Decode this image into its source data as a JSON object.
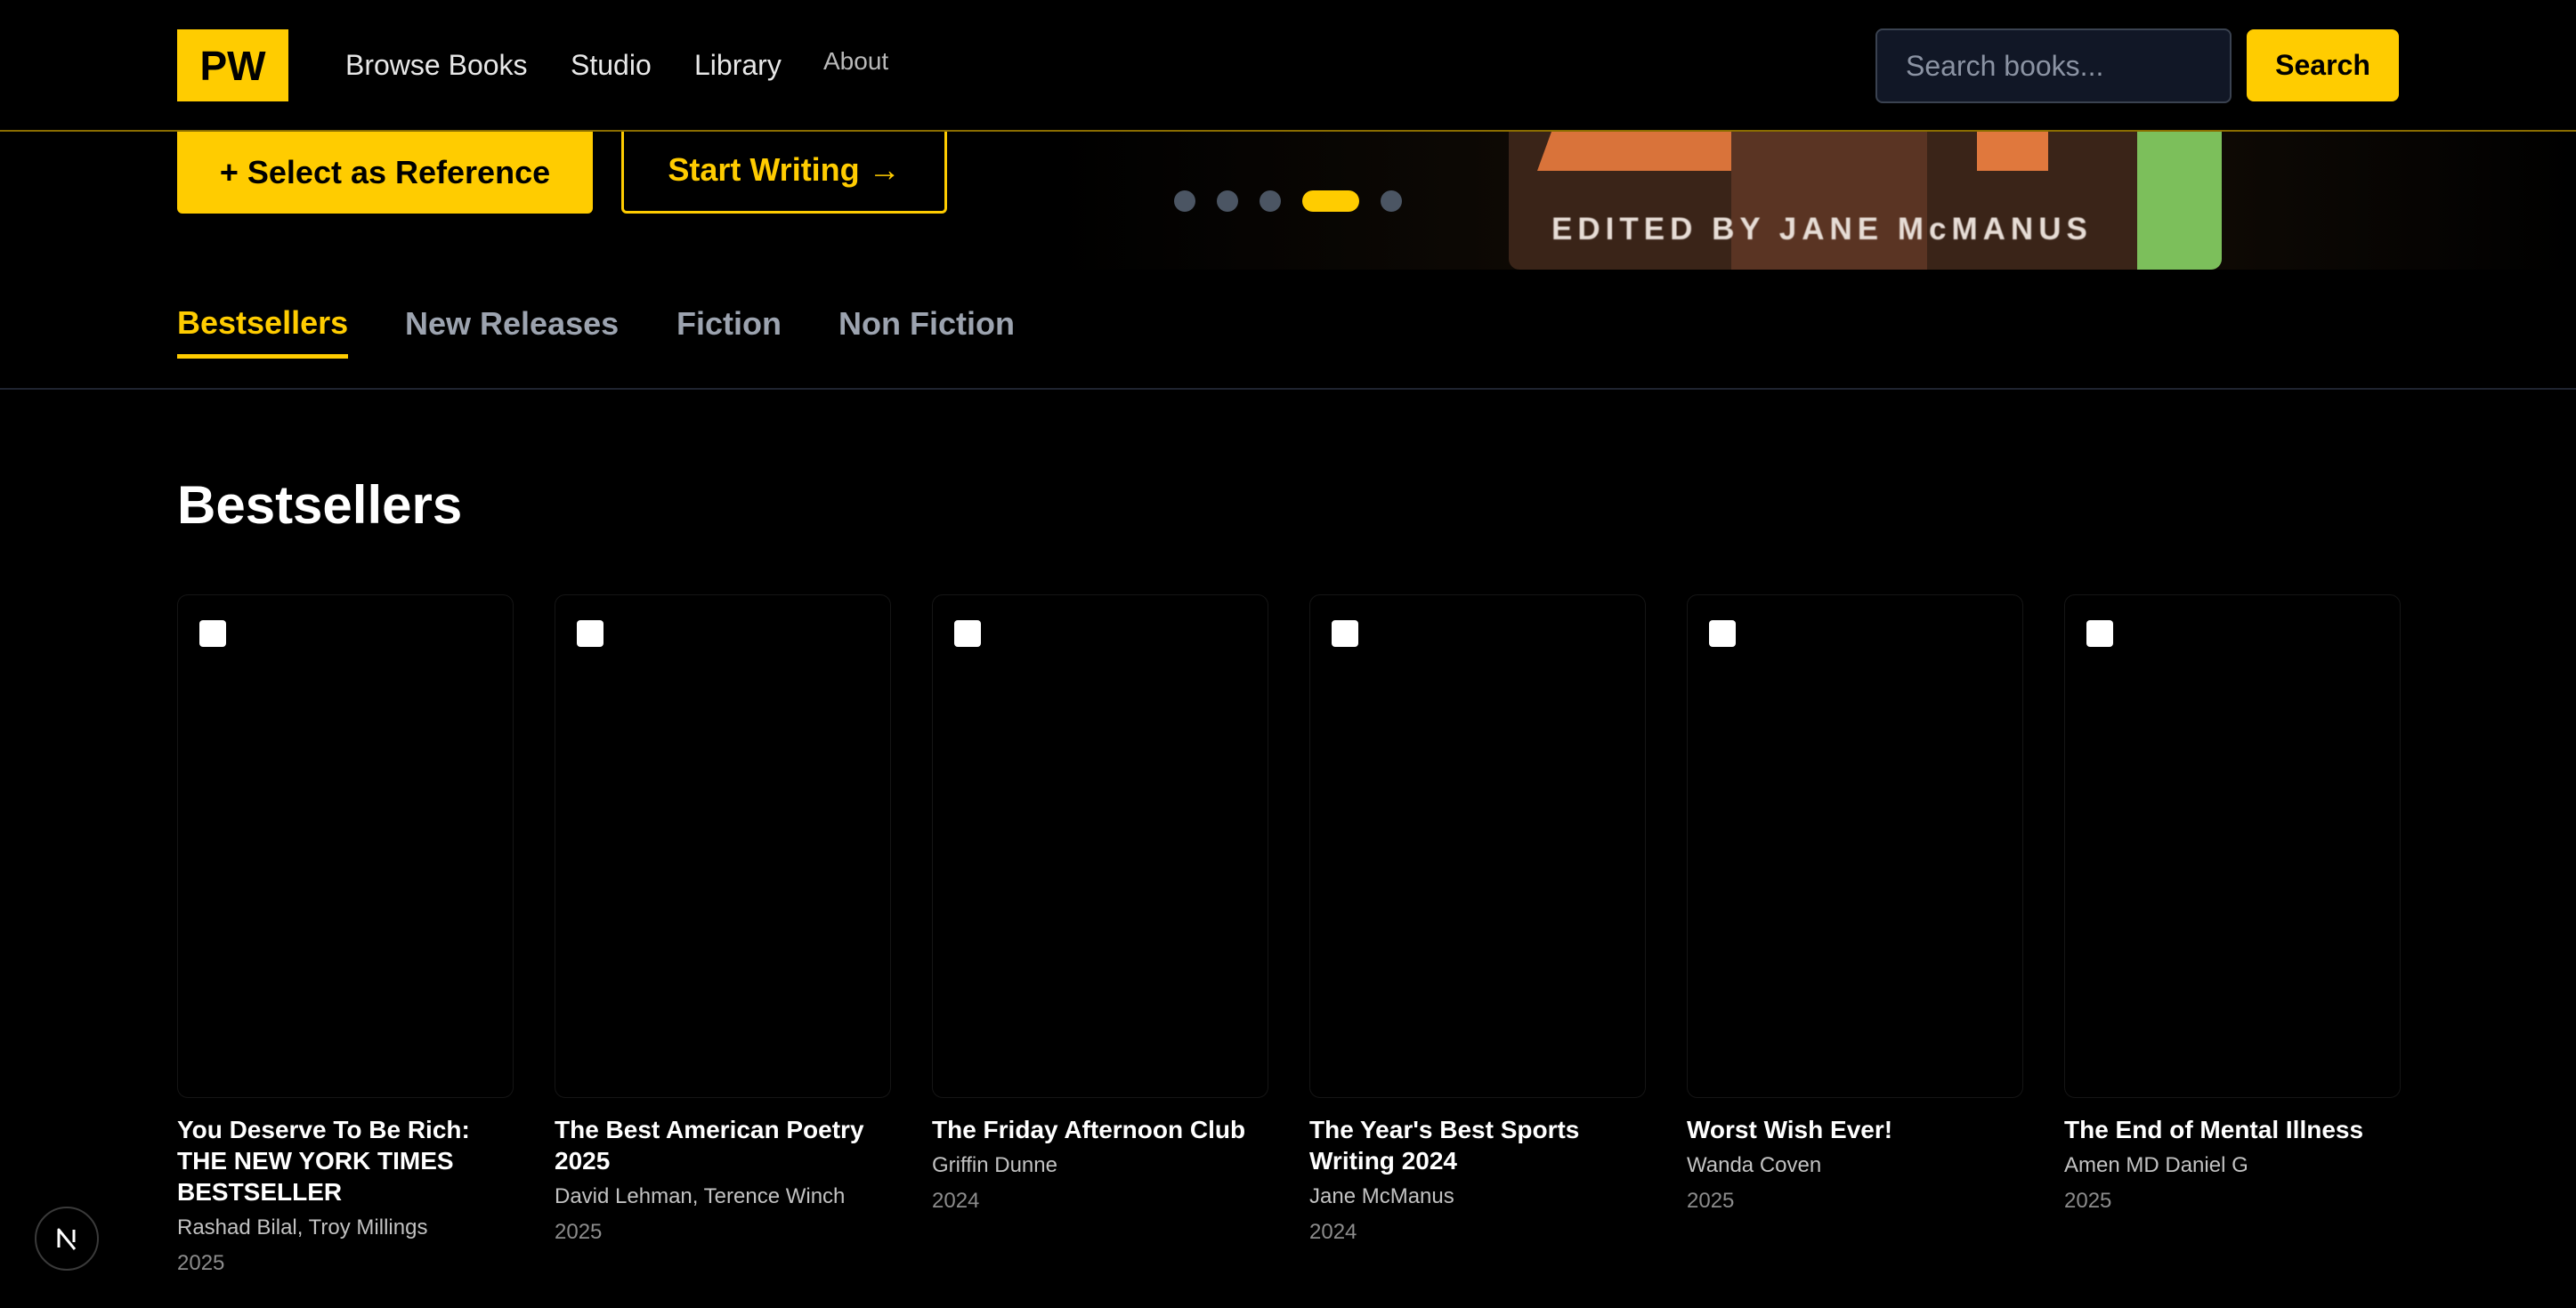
{
  "header": {
    "logo": "PW",
    "nav": [
      "Browse Books",
      "Studio",
      "Library",
      "About"
    ],
    "search": {
      "placeholder": "Search books...",
      "value": "",
      "button_label": "Search"
    }
  },
  "hero": {
    "select_reference_label": "+ Select as Reference",
    "start_writing_label": "Start Writing →",
    "carousel": {
      "total_slides": 5,
      "active_index": 3
    },
    "cover_text": "EDITED BY JANE McMANUS"
  },
  "tabs": [
    "Bestsellers",
    "New Releases",
    "Fiction",
    "Non Fiction"
  ],
  "active_tab": "Bestsellers",
  "section": {
    "title": "Bestsellers",
    "books": [
      {
        "title": "You Deserve To Be Rich: THE NEW YORK TIMES BESTSELLER",
        "author": "Rashad Bilal, Troy Millings",
        "year": "2025",
        "selected": false
      },
      {
        "title": "The Best American Poetry 2025",
        "author": "David Lehman, Terence Winch",
        "year": "2025",
        "selected": false
      },
      {
        "title": "The Friday Afternoon Club",
        "author": "Griffin Dunne",
        "year": "2024",
        "selected": false
      },
      {
        "title": "The Year's Best Sports Writing 2024",
        "author": "Jane McManus",
        "year": "2024",
        "selected": false
      },
      {
        "title": "Worst Wish Ever!",
        "author": "Wanda Coven",
        "year": "2025",
        "selected": false
      },
      {
        "title": "The End of Mental Illness",
        "author": "Amen MD Daniel G",
        "year": "2025",
        "selected": false
      }
    ]
  },
  "colors": {
    "accent": "#ffcc00",
    "background": "#000000",
    "muted_text": "#9ca3af",
    "dot_inactive": "#4b5563"
  },
  "icons": {
    "floating_badge": "nextjs-n-icon"
  }
}
